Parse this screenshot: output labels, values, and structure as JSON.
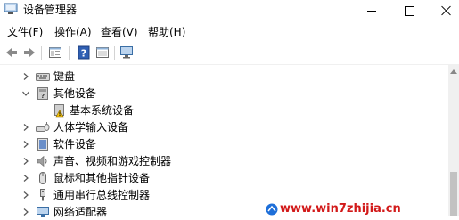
{
  "window": {
    "title": "设备管理器"
  },
  "menu": [
    {
      "label": "文件(F)"
    },
    {
      "label": "操作(A)"
    },
    {
      "label": "查看(V)"
    },
    {
      "label": "帮助(H)"
    }
  ],
  "toolbar": {
    "buttons": [
      "back-icon",
      "forward-icon",
      "properties-icon",
      "help-icon",
      "panel-icon",
      "monitor-icon"
    ]
  },
  "tree": [
    {
      "label": "键盘",
      "expanded": false,
      "icon": "keyboard-icon"
    },
    {
      "label": "其他设备",
      "expanded": true,
      "icon": "other-devices-icon"
    },
    {
      "label": "基本系统设备",
      "child": true,
      "icon": "warning-device-icon"
    },
    {
      "label": "人体学输入设备",
      "expanded": false,
      "icon": "hid-icon"
    },
    {
      "label": "软件设备",
      "expanded": false,
      "icon": "software-device-icon"
    },
    {
      "label": "声音、视频和游戏控制器",
      "expanded": false,
      "icon": "speaker-icon"
    },
    {
      "label": "鼠标和其他指针设备",
      "expanded": false,
      "icon": "mouse-icon"
    },
    {
      "label": "通用串行总线控制器",
      "expanded": false,
      "icon": "usb-icon"
    },
    {
      "label": "网络适配器",
      "expanded": false,
      "icon": "network-icon"
    }
  ],
  "watermark": {
    "text": "www.win7zhijia.cn"
  },
  "colors": {
    "watermark": "#d21a1a",
    "accent": "#1e6fd9"
  }
}
